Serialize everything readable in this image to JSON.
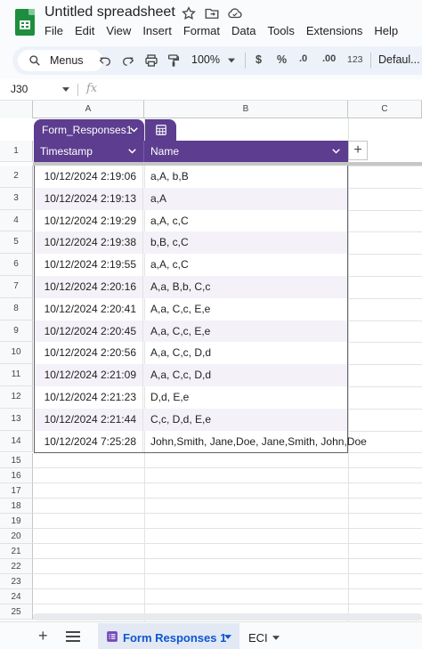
{
  "window": {
    "doc_title": "Untitled spreadsheet"
  },
  "menu": [
    "File",
    "Edit",
    "View",
    "Insert",
    "Format",
    "Data",
    "Tools",
    "Extensions",
    "Help"
  ],
  "toolbar": {
    "search_label": "Menus",
    "zoom": "100%",
    "currency": "$",
    "percent": "%",
    "dec_decrease": ".0",
    "dec_increase": ".00",
    "number_format": "123",
    "font": "Defaul..."
  },
  "formula_bar": {
    "cell_ref": "J30",
    "fx": "fx"
  },
  "columns": [
    "A",
    "B",
    "C"
  ],
  "row_numbers": [
    "1",
    "2",
    "3",
    "4",
    "5",
    "6",
    "7",
    "8",
    "9",
    "10",
    "11",
    "12",
    "13",
    "14",
    "15",
    "16",
    "17",
    "18",
    "19",
    "20",
    "21",
    "22",
    "23",
    "24",
    "25"
  ],
  "table": {
    "name": "Form_Responses1",
    "headers": [
      "Timestamp",
      "Name"
    ],
    "rows": [
      [
        "10/12/2024 2:19:06",
        "a,A, b,B"
      ],
      [
        "10/12/2024 2:19:13",
        "a,A"
      ],
      [
        "10/12/2024 2:19:29",
        "a,A, c,C"
      ],
      [
        "10/12/2024 2:19:38",
        "b,B, c,C"
      ],
      [
        "10/12/2024 2:19:55",
        "a,A, c,C"
      ],
      [
        "10/12/2024 2:20:16",
        "A,a, B,b, C,c"
      ],
      [
        "10/12/2024 2:20:41",
        "A,a, C,c, E,e"
      ],
      [
        "10/12/2024 2:20:45",
        "A,a, C,c, E,e"
      ],
      [
        "10/12/2024 2:20:56",
        "A,a, C,c, D,d"
      ],
      [
        "10/12/2024 2:21:09",
        "A,a, C,c, D,d"
      ],
      [
        "10/12/2024 2:21:23",
        "D,d, E,e"
      ],
      [
        "10/12/2024 2:21:44",
        "C,c, D,d, E,e"
      ],
      [
        "10/12/2024 7:25:28",
        "John,Smith, Jane,Doe, Jane,Smith, John,Doe"
      ]
    ]
  },
  "sheets": {
    "active": "Form Responses 1",
    "other": "ECI"
  },
  "colors": {
    "table_header": "#5c3d8f",
    "active_sheet_text": "#0b57d0",
    "logo": "#1e8e3e"
  }
}
